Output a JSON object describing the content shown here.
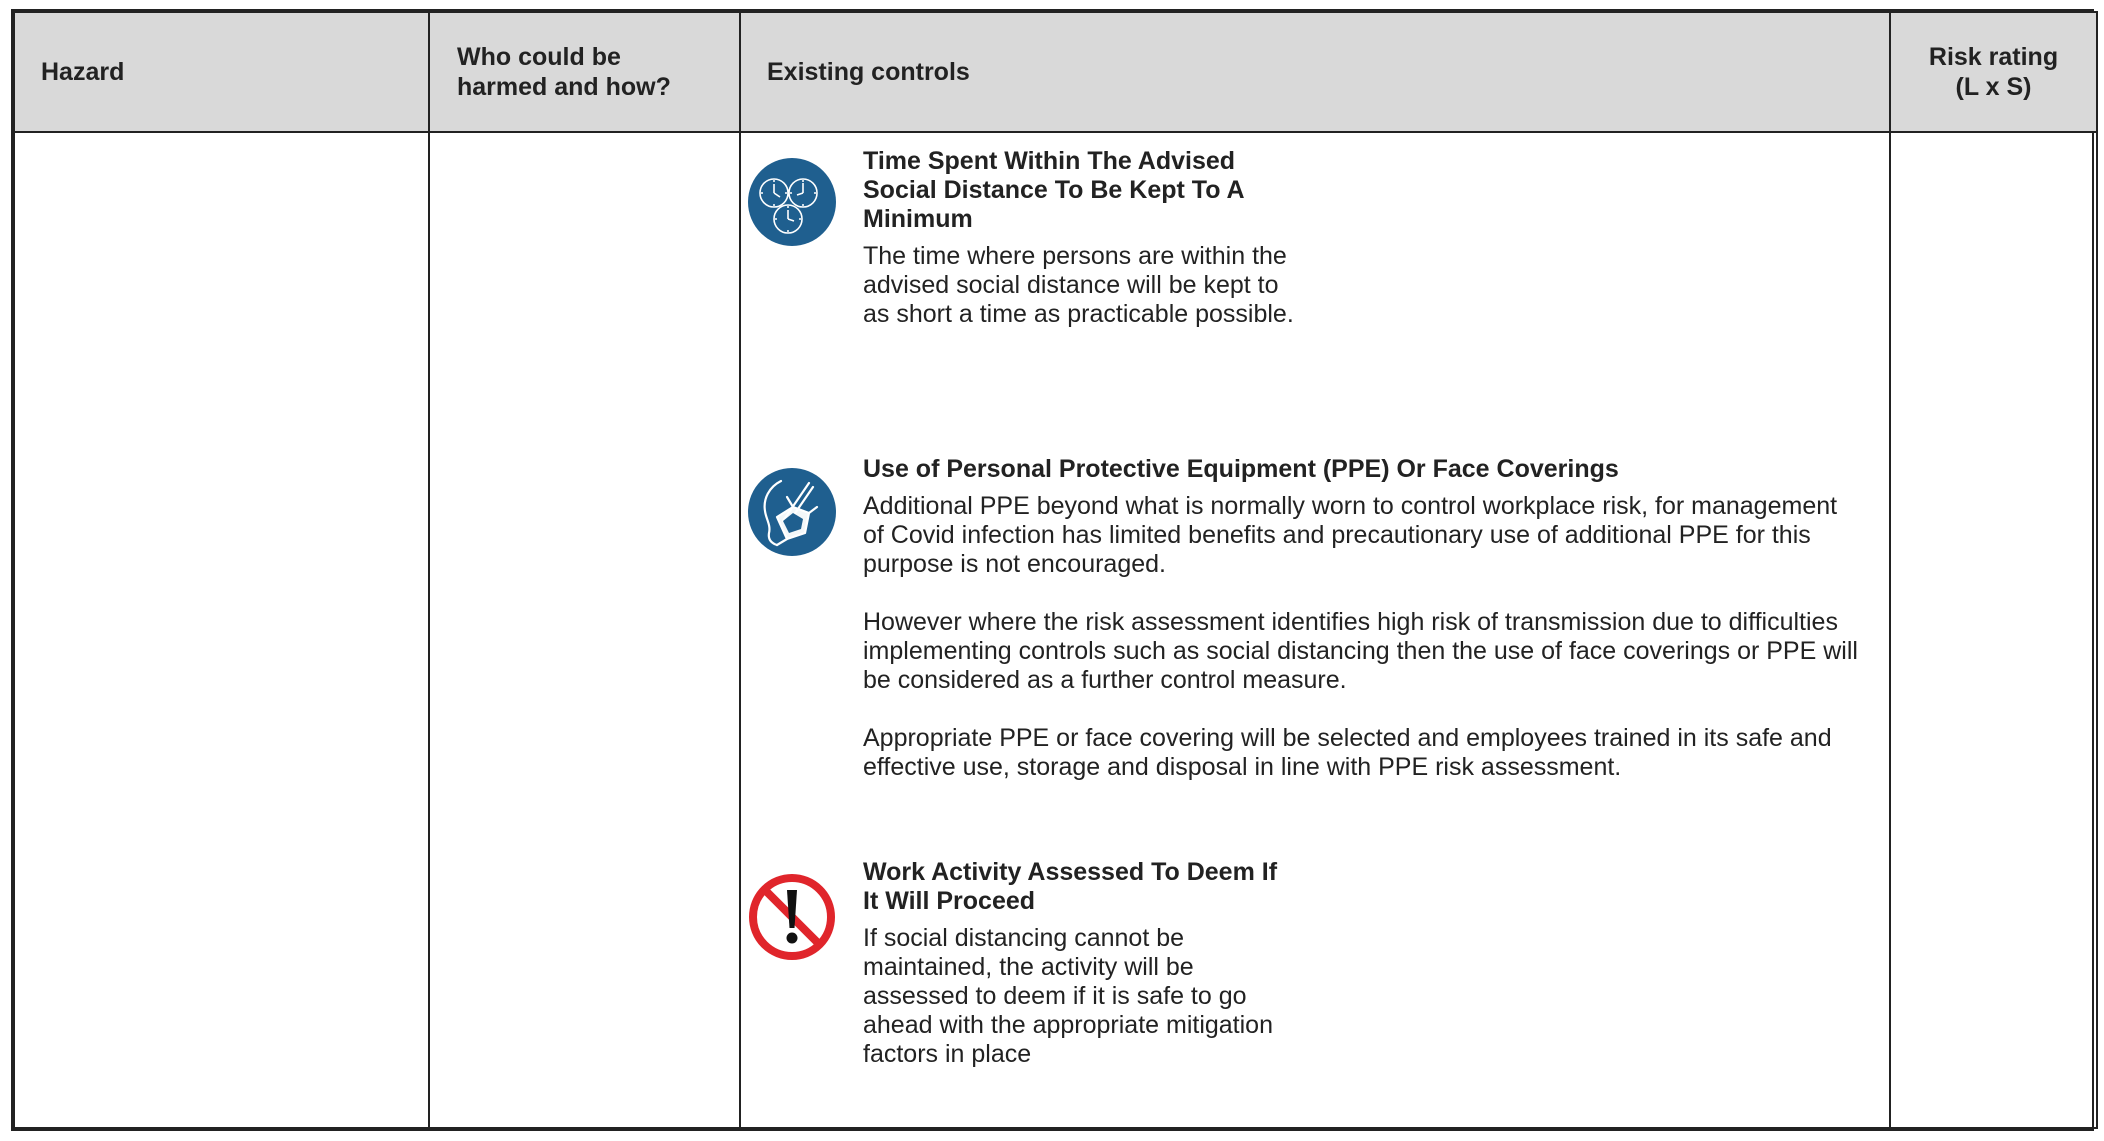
{
  "table": {
    "headers": {
      "hazard": "Hazard",
      "who_line1": "Who could be",
      "who_line2": "harmed and how?",
      "controls": "Existing controls",
      "rating_line1": "Risk rating",
      "rating_line2": "(L x S)"
    },
    "row": {
      "hazard": "",
      "who": "",
      "rating": ""
    }
  },
  "controls": [
    {
      "icon": "clocks-icon",
      "title": "Time Spent Within The Advised Social Distance To Be Kept To A Minimum",
      "paragraphs": [
        "The time where persons are within the advised social distance will be kept to as short a time as practicable possible."
      ]
    },
    {
      "icon": "face-mask-icon",
      "title": "Use of Personal Protective Equipment (PPE) Or Face Coverings",
      "paragraphs": [
        "Additional PPE beyond what is normally worn to control workplace risk, for management of Covid infection has limited benefits and precautionary use of additional PPE for this purpose is not encouraged.",
        "However where the risk assessment identifies high risk of transmission due to difficulties implementing controls such as social distancing then the use of face coverings or PPE will be considered as a further control measure.",
        "Appropriate PPE or face covering will be selected and employees trained in its safe and effective use, storage and disposal in line with PPE risk assessment."
      ]
    },
    {
      "icon": "prohibited-warning-icon",
      "title": "Work Activity Assessed To Deem If It Will Proceed",
      "paragraphs": [
        "If social distancing cannot be maintained, the activity will be assessed to deem if it is safe to go ahead with the appropriate mitigation factors in place"
      ]
    }
  ],
  "colors": {
    "header_bg": "#d9d9d9",
    "border": "#222222",
    "icon_blue": "#1f5f8f",
    "icon_red": "#e0252b"
  }
}
